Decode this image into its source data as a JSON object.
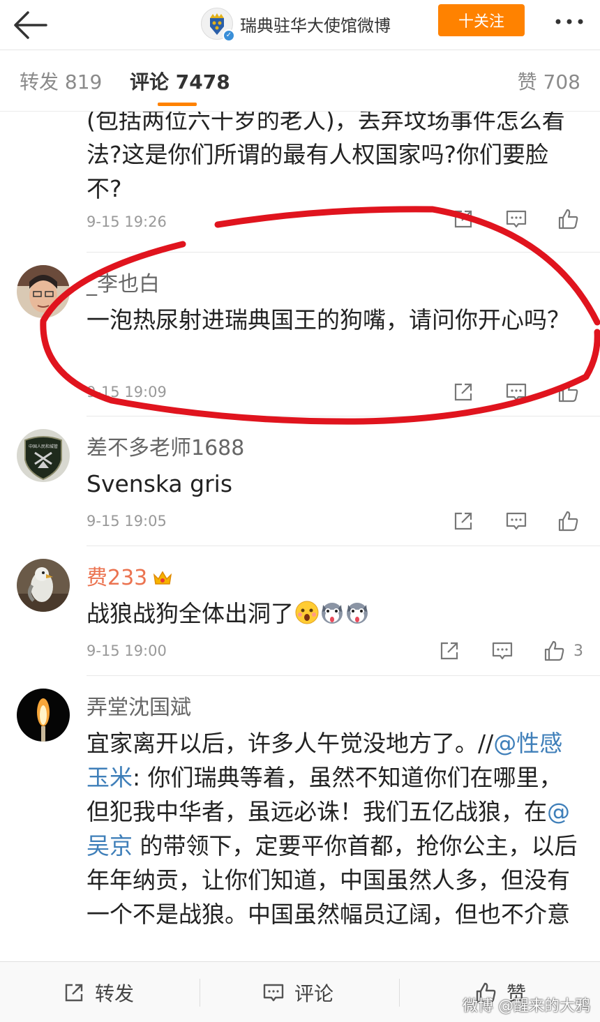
{
  "header": {
    "account_name": "瑞典驻华大使馆微博",
    "follow_label": "十关注"
  },
  "tabs": {
    "repost": "转发 819",
    "comment": "评论 7478",
    "like": "赞 708"
  },
  "comments": [
    {
      "user": "",
      "text": "(包括两位六十岁的老人)，丢弃坟场事件怎么看法?这是你们所谓的最有人权国家吗?你们要脸不?",
      "time": "9-15 19:26",
      "likes": ""
    },
    {
      "user": "_李也白",
      "text": "一泡热尿射进瑞典国王的狗嘴，请问你开心吗？",
      "time": "9-15 19:09",
      "likes": ""
    },
    {
      "user": "差不多老师1688",
      "text": "Svenska gris",
      "time": "9-15 19:05",
      "likes": ""
    },
    {
      "user": "费233",
      "text": "战狼战狗全体出洞了",
      "time": "9-15 19:00",
      "likes": "3"
    },
    {
      "user": "弄堂沈国斌",
      "text_parts": {
        "p1": "宜家离开以后，许多人午觉没地方了。//",
        "mention1": "@性感玉米",
        "p2": ": 你们瑞典等着，虽然不知道你们在哪里，但犯我中华者，虽远必诛！我们五亿战狼，在",
        "mention2": "@吴京",
        "p3": " 的带领下，定要平你首都，抢你公主，以后年年纳贡，让你们知道，中国虽然人多，但没有一个不是战狼。中国虽然幅员辽阔，但也不介意"
      }
    }
  ],
  "badge_text": "中国人民和城管",
  "bottom_bar": {
    "repost": "转发",
    "comment": "评论",
    "like": "赞"
  },
  "watermark": "微博 @醒来的大鸦",
  "colors": {
    "accent": "#ff8200",
    "mention": "#3f7fb9",
    "annotation": "#e0141e"
  }
}
